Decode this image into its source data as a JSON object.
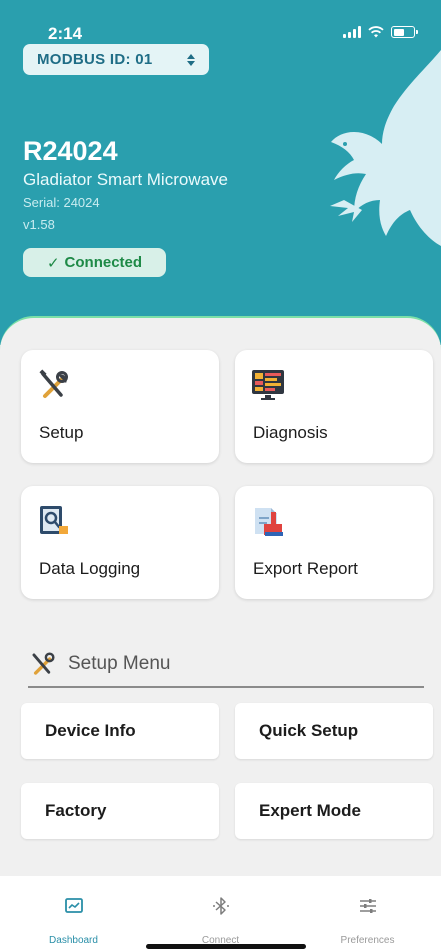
{
  "status_bar": {
    "time": "2:14"
  },
  "header": {
    "modbus_label": "MODBUS ID: 01",
    "device_name": "R24024",
    "device_model": "Gladiator Smart Microwave",
    "serial": "Serial: 24024",
    "version": "v1.58",
    "connection_status": "Connected",
    "connection_check": "✓"
  },
  "tiles": [
    {
      "label": "Setup",
      "icon": "wrench-screwdriver-icon"
    },
    {
      "label": "Diagnosis",
      "icon": "monitor-dashboard-icon"
    },
    {
      "label": "Data Logging",
      "icon": "data-log-icon"
    },
    {
      "label": "Export Report",
      "icon": "export-report-icon"
    }
  ],
  "setup_menu": {
    "title": "Setup Menu",
    "items": [
      "Device Info",
      "Quick Setup",
      "Factory",
      "Expert Mode"
    ]
  },
  "tabbar": {
    "items": [
      {
        "label": "Dashboard",
        "icon": "chart-monitor-icon",
        "active": true
      },
      {
        "label": "Connect",
        "icon": "bluetooth-icon",
        "active": false
      },
      {
        "label": "Preferences",
        "icon": "sliders-icon",
        "active": false
      }
    ]
  },
  "colors": {
    "header_bg": "#2a9fae",
    "accent_line": "#7be0a7",
    "connected_text": "#1e8a47",
    "active_tab": "#2a8fa8"
  }
}
